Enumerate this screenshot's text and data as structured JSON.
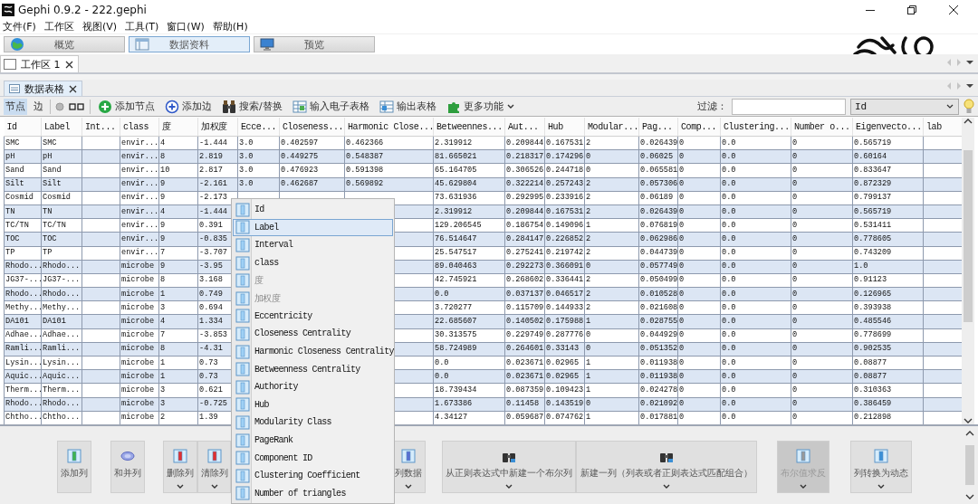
{
  "window": {
    "title": "Gephi 0.9.2 - 222.gephi"
  },
  "menu": [
    "文件(F)",
    "工作区",
    "视图(V)",
    "工具(T)",
    "窗口(W)",
    "帮助(H)"
  ],
  "perspectives": [
    {
      "label": "概览",
      "selected": false
    },
    {
      "label": "数据资料",
      "selected": true
    },
    {
      "label": "预览",
      "selected": false
    }
  ],
  "workspace_tabs": [
    {
      "label": "工作区 1",
      "selected": true
    }
  ],
  "panel_tabs": [
    {
      "label": "数据表格",
      "selected": true
    }
  ],
  "view_toggle": [
    {
      "label": "节点",
      "selected": true
    },
    {
      "label": "边",
      "selected": false
    }
  ],
  "toolbar": [
    "添加节点",
    "添加边",
    "搜索/替换",
    "输入电子表格",
    "输出表格",
    "更多功能"
  ],
  "filter": {
    "label": "过滤：",
    "column": "Id"
  },
  "table": {
    "columns": [
      "Id",
      "Label",
      "Int...",
      "class",
      "度",
      "加权度",
      "Ecce...",
      "Closeness...",
      "Harmonic Close...",
      "Betweennes...",
      "Aut...",
      "Hub",
      "Modular...",
      "Pag...",
      "Comp...",
      "Clustering...",
      "Number o...",
      "Eigenvecto...",
      "lab"
    ],
    "rows": [
      [
        "SMC",
        "SMC",
        null,
        "envir...",
        "4",
        "-1.444",
        "3.0",
        "0.402597",
        "0.462366",
        "2.319912",
        "0.209844",
        "0.167531",
        "2",
        "0.026439",
        "0",
        "0.0",
        "0",
        "0.565719",
        null
      ],
      [
        "pH",
        "pH",
        null,
        "envir...",
        "8",
        "2.819",
        "3.0",
        "0.449275",
        "0.548387",
        "81.665021",
        "0.218317",
        "0.174296",
        "0",
        "0.06025",
        "0",
        "0.0",
        "0",
        "0.60164",
        null
      ],
      [
        "Sand",
        "Sand",
        null,
        "envir...",
        "10",
        "2.817",
        "3.0",
        "0.476923",
        "0.591398",
        "65.164705",
        "0.306526",
        "0.244718",
        "0",
        "0.065581",
        "0",
        "0.0",
        "0",
        "0.833647",
        null
      ],
      [
        "Silt",
        "Silt",
        null,
        "envir...",
        "9",
        "-2.161",
        "3.0",
        "0.462687",
        "0.569892",
        "45.629804",
        "0.322214",
        "0.257243",
        "2",
        "0.057306",
        "0",
        "0.0",
        "0",
        "0.872329",
        null
      ],
      [
        "Cosmid",
        "Cosmid",
        null,
        "envir...",
        "9",
        "-2.173",
        null,
        null,
        null,
        "73.631936",
        "0.292995",
        "0.233916",
        "2",
        "0.06189",
        "0",
        "0.0",
        "0",
        "0.799137",
        null
      ],
      [
        "TN",
        "TN",
        null,
        "envir...",
        "4",
        "-1.444",
        null,
        null,
        null,
        "2.319912",
        "0.209844",
        "0.167531",
        "2",
        "0.026439",
        "0",
        "0.0",
        "0",
        "0.565719",
        null
      ],
      [
        "TC/TN",
        "TC/TN",
        null,
        "envir...",
        "9",
        "0.391",
        null,
        null,
        null,
        "129.206545",
        "0.186754",
        "0.149096",
        "1",
        "0.076819",
        "0",
        "0.0",
        "0",
        "0.531411",
        null
      ],
      [
        "TOC",
        "TOC",
        null,
        "envir...",
        "9",
        "-0.835",
        null,
        null,
        null,
        "76.514647",
        "0.284147",
        "0.226852",
        "2",
        "0.062986",
        "0",
        "0.0",
        "0",
        "0.778605",
        null
      ],
      [
        "TP",
        "TP",
        null,
        "envir...",
        "7",
        "-3.707",
        null,
        null,
        null,
        "25.547517",
        "0.275241",
        "0.219742",
        "2",
        "0.044739",
        "0",
        "0.0",
        "0",
        "0.743209",
        null
      ],
      [
        "Rhodo...",
        "Rhodo...",
        null,
        "microbe",
        "9",
        "-3.95",
        null,
        null,
        null,
        "89.040463",
        "0.292273",
        "0.366091",
        "0",
        "0.057749",
        "0",
        "0.0",
        "0",
        "1.0",
        null
      ],
      [
        "JG37-...",
        "JG37-...",
        null,
        "microbe",
        "8",
        "3.168",
        null,
        null,
        null,
        "42.745921",
        "0.268602",
        "0.336441",
        "2",
        "0.050499",
        "0",
        "0.0",
        "0",
        "0.91123",
        null
      ],
      [
        "Rhodo...",
        "Rhodo...",
        null,
        "microbe",
        "1",
        "0.749",
        null,
        null,
        null,
        "0.0",
        "0.037137",
        "0.046517",
        "2",
        "0.010528",
        "0",
        "0.0",
        "0",
        "0.126965",
        null
      ],
      [
        "Methy...",
        "Methy...",
        null,
        "microbe",
        "3",
        "0.694",
        null,
        null,
        null,
        "3.720277",
        "0.115709",
        "0.144933",
        "2",
        "0.021608",
        "0",
        "0.0",
        "0",
        "0.393938",
        null
      ],
      [
        "DA101",
        "DA101",
        null,
        "microbe",
        "4",
        "1.334",
        null,
        null,
        null,
        "22.685607",
        "0.140502",
        "0.175988",
        "1",
        "0.028755",
        "0",
        "0.0",
        "0",
        "0.485546",
        null
      ],
      [
        "Adhae...",
        "Adhae...",
        null,
        "microbe",
        "7",
        "-3.853",
        null,
        null,
        null,
        "30.313575",
        "0.229749",
        "0.287776",
        "0",
        "0.044929",
        "0",
        "0.0",
        "0",
        "0.778699",
        null
      ],
      [
        "Ramli...",
        "Ramli...",
        null,
        "microbe",
        "8",
        "-4.31",
        null,
        null,
        null,
        "58.724989",
        "0.264601",
        "0.33143",
        "0",
        "0.051352",
        "0",
        "0.0",
        "0",
        "0.902535",
        null
      ],
      [
        "Lysin...",
        "Lysin...",
        null,
        "microbe",
        "1",
        "0.73",
        null,
        null,
        null,
        "0.0",
        "0.023671",
        "0.02965",
        "1",
        "0.011938",
        "0",
        "0.0",
        "0",
        "0.08877",
        null
      ],
      [
        "Aquic...",
        "Aquic...",
        null,
        "microbe",
        "1",
        "0.73",
        null,
        null,
        null,
        "0.0",
        "0.023671",
        "0.02965",
        "1",
        "0.011938",
        "0",
        "0.0",
        "0",
        "0.08877",
        null
      ],
      [
        "Therm...",
        "Therm...",
        null,
        "microbe",
        "3",
        "0.621",
        null,
        null,
        null,
        "18.739434",
        "0.087359",
        "0.109423",
        "1",
        "0.024278",
        "0",
        "0.0",
        "0",
        "0.310363",
        null
      ],
      [
        "Rhodo...",
        "Rhodo...",
        null,
        "microbe",
        "3",
        "-0.725",
        null,
        null,
        null,
        "1.673386",
        "0.11458",
        "0.143519",
        "0",
        "0.021092",
        "0",
        "0.0",
        "0",
        "0.386459",
        null
      ],
      [
        "Chtho...",
        "Chtho...",
        null,
        "microbe",
        "2",
        "1.39",
        null,
        null,
        null,
        "4.34127",
        "0.059687",
        "0.074762",
        "1",
        "0.017881",
        "0",
        "0.0",
        "0",
        "0.212898",
        null
      ]
    ]
  },
  "column_menu": [
    {
      "label": "Id",
      "selected": false,
      "disabled": false
    },
    {
      "label": "Label",
      "selected": true,
      "disabled": false
    },
    {
      "label": "Interval",
      "selected": false,
      "disabled": false
    },
    {
      "label": "class",
      "selected": false,
      "disabled": false
    },
    {
      "label": "度",
      "selected": false,
      "disabled": true
    },
    {
      "label": "加权度",
      "selected": false,
      "disabled": true
    },
    {
      "label": "Eccentricity",
      "selected": false,
      "disabled": false
    },
    {
      "label": "Closeness Centrality",
      "selected": false,
      "disabled": false
    },
    {
      "label": "Harmonic Closeness Centrality",
      "selected": false,
      "disabled": false
    },
    {
      "label": "Betweenness Centrality",
      "selected": false,
      "disabled": false
    },
    {
      "label": "Authority",
      "selected": false,
      "disabled": false
    },
    {
      "label": "Hub",
      "selected": false,
      "disabled": false
    },
    {
      "label": "Modularity Class",
      "selected": false,
      "disabled": false
    },
    {
      "label": "PageRank",
      "selected": false,
      "disabled": false
    },
    {
      "label": "Component ID",
      "selected": false,
      "disabled": false
    },
    {
      "label": "Clustering Coefficient",
      "selected": false,
      "disabled": false
    },
    {
      "label": "Number of triangles",
      "selected": false,
      "disabled": false
    }
  ],
  "column_actions": [
    {
      "label": "添加列",
      "dropdown": false,
      "disabled": false
    },
    {
      "label": "和并列",
      "dropdown": false,
      "disabled": false
    },
    {
      "label": "删除列",
      "dropdown": true,
      "disabled": false
    },
    {
      "label": "清除列",
      "dropdown": true,
      "disabled": false
    },
    {
      "label": "列数据",
      "dropdown": true,
      "disabled": false
    },
    {
      "label": "从正则表达式中新建一个布尔列",
      "dropdown": true,
      "disabled": false
    },
    {
      "label": "新建一列（列表或者正则表达式匹配组合）",
      "dropdown": true,
      "disabled": false
    },
    {
      "label": "布尔值求反",
      "dropdown": true,
      "disabled": true
    },
    {
      "label": "列转换为动态",
      "dropdown": true,
      "disabled": false
    }
  ]
}
